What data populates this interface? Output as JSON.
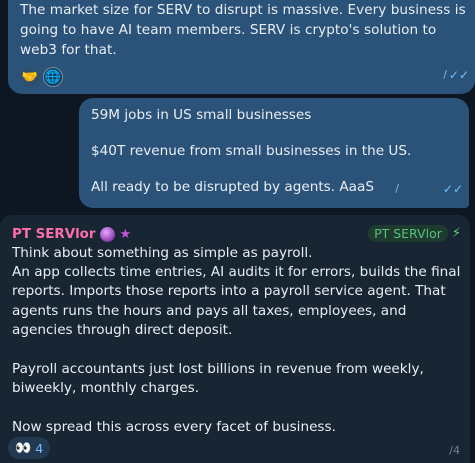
{
  "msg1": {
    "text": "The market size for SERV to disrupt is massive.  Every business is going to have AI team members.  SERV is crypto's solution to web3 for that.",
    "reactions": [
      "🤝",
      "🌐"
    ],
    "time_glyph": "/",
    "ticks": "✓✓"
  },
  "msg2": {
    "line1": "59M jobs in US small businesses",
    "line2": "$40T revenue from small businesses in the US.",
    "line3": "All ready to be disrupted by agents.  AaaS",
    "time_glyph": "/",
    "ticks": "✓✓"
  },
  "msg3": {
    "sender": "PT SERVlor",
    "sender_emoji": "🔮",
    "star": "★",
    "badge": "PT SERVlor",
    "bolt": "⚡",
    "para1": "Think about something as simple as payroll.\nAn app collects time entries, AI audits it for errors, builds the final reports.  Imports those reports into a payroll service agent.  That agents runs the hours and pays all taxes, employees, and agencies through direct deposit.",
    "para2": "Payroll accountants just lost billions in revenue from weekly, biweekly, monthly charges.",
    "para3": "Now spread this across every facet of business.",
    "reaction_emoji": "👀",
    "reaction_count": "4",
    "time_glyph": "/4"
  }
}
